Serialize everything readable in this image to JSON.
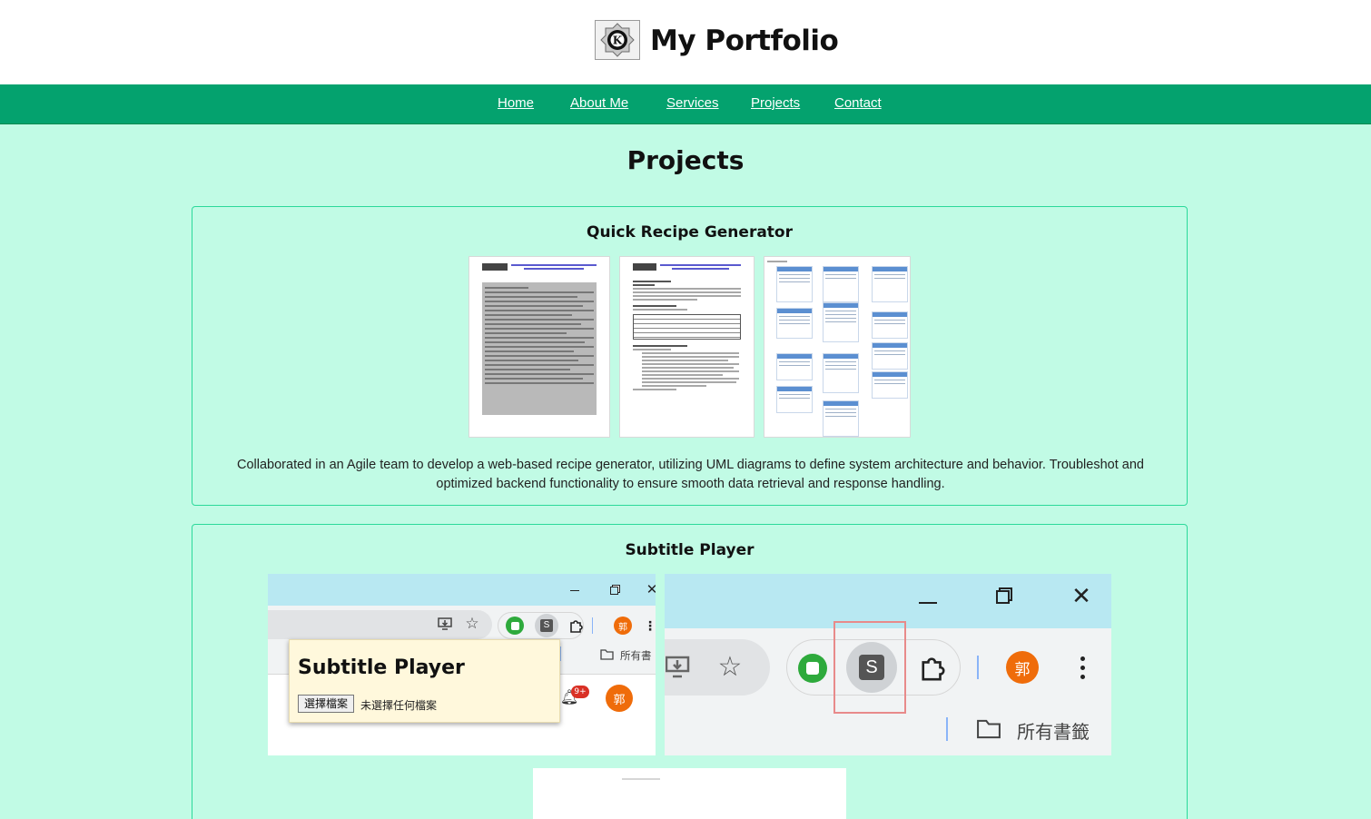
{
  "header": {
    "site_title": "My Portfolio",
    "logo_letter": "K"
  },
  "nav": {
    "items": [
      "Home",
      "About Me",
      "Services",
      "Projects",
      "Contact"
    ]
  },
  "page": {
    "heading": "Projects"
  },
  "projects": [
    {
      "title": "Quick Recipe Generator",
      "description": "Collaborated in an Agile team to develop a web-based recipe generator, utilizing UML diagrams to define system architecture and behavior. Troubleshot and optimized backend functionality to ensure smooth data retrieval and response handling.",
      "images": [
        "table-of-contents-document",
        "introduction-document",
        "uml-class-diagram"
      ]
    },
    {
      "title": "Subtitle Player",
      "popup": {
        "title": "Subtitle Player",
        "file_button": "選擇檔案",
        "file_status": "未選擇任何檔案"
      },
      "browser": {
        "bookmarks_label": "所有書籤",
        "bookmarks_label_partial": "所有書",
        "avatar_char": "郭",
        "extension_letter": "S",
        "notification_badge": "9+"
      }
    }
  ],
  "colors": {
    "page_bg": "#c1fbe5",
    "nav_bg": "#04a26e",
    "card_border": "#2bd99a",
    "browser_titlebar": "#b8e8f2",
    "highlight_box": "#e88a8a"
  }
}
